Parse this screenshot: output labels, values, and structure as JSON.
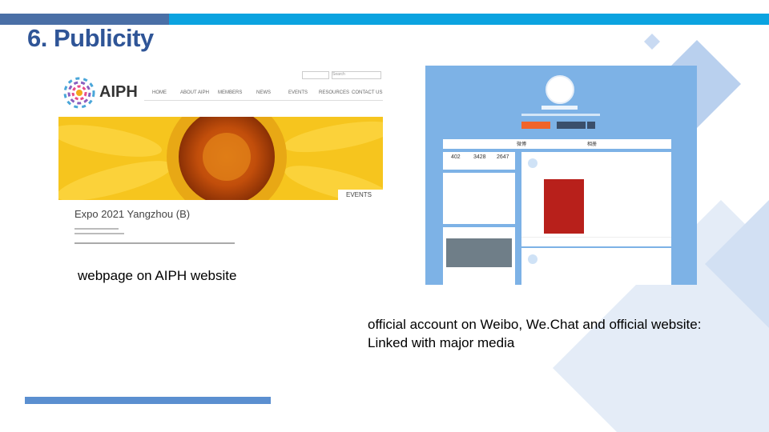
{
  "slide": {
    "title": "6. Publicity",
    "caption_left": "webpage on AIPH website",
    "caption_right_line1": "official account on Weibo, We.Chat and official website:",
    "caption_right_line2": "Linked with major media"
  },
  "aiph_site": {
    "logo_text": "AIPH",
    "nav": [
      "HOME",
      "ABOUT AIPH",
      "MEMBERS",
      "NEWS",
      "EVENTS",
      "RESOURCES",
      "CONTACT US"
    ],
    "search_placeholder": "Search",
    "events_tag": "EVENTS",
    "page_heading": "Expo 2021 Yangzhou (B)"
  },
  "weibo": {
    "stats": [
      "402",
      "3428",
      "2647"
    ],
    "tabs": [
      "微博",
      "相册"
    ]
  },
  "colors": {
    "title": "#2f5597",
    "bar_dark": "#4a6fa6",
    "bar_light": "#0ba3e0",
    "weibo_bg": "#7db2e6"
  }
}
